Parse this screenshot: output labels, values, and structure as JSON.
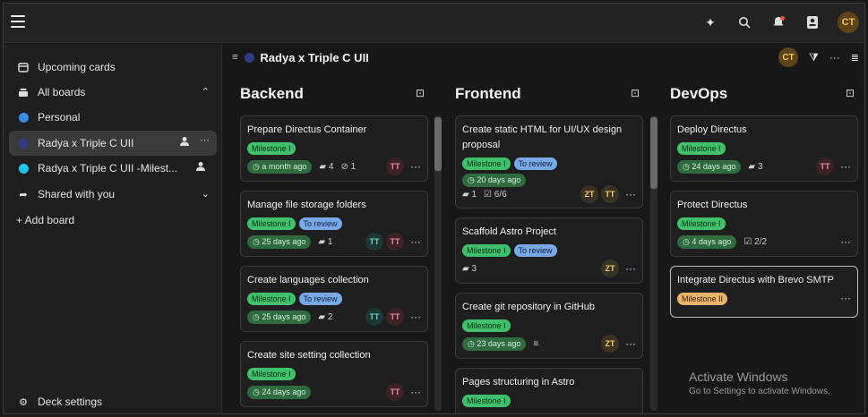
{
  "sidebar": {
    "upcoming": "Upcoming cards",
    "all_boards": "All boards",
    "personal": "Personal",
    "radya": "Radya x Triple C UII",
    "radya_milestone": "Radya x Triple C UII -Milest...",
    "shared": "Shared with you",
    "add_board": "+ Add board",
    "settings": "Deck settings",
    "colors": {
      "personal": "#3b8fe0",
      "radya": "#2f3d80",
      "milestone": "#20c6e8"
    }
  },
  "topbar": {
    "avatar": "CT"
  },
  "board": {
    "title": "Radya x Triple C UII",
    "avatar": "CT"
  },
  "columns": [
    {
      "title": "Backend",
      "cards": [
        {
          "title": "Prepare Directus Container",
          "tags": [
            "Milestone I"
          ],
          "due": "a month ago",
          "comments": "4",
          "attachments": "1",
          "avatars": [
            "TT"
          ]
        },
        {
          "title": "Manage file storage folders",
          "tags": [
            "Milestone I",
            "To review"
          ],
          "due": "25 days ago",
          "comments": "1",
          "avatars": [
            "TT",
            "TT"
          ]
        },
        {
          "title": "Create languages collection",
          "tags": [
            "Milestone I",
            "To review"
          ],
          "due": "25 days ago",
          "comments": "2",
          "avatars": [
            "TT",
            "TT"
          ]
        },
        {
          "title": "Create site setting collection",
          "tags": [
            "Milestone I"
          ],
          "due": "24 days ago",
          "avatars": [
            "TT"
          ]
        }
      ]
    },
    {
      "title": "Frontend",
      "cards": [
        {
          "title": "Create static HTML for UI/UX design proposal",
          "tags": [
            "Milestone I",
            "To review"
          ],
          "due": "20 days ago",
          "comments": "1",
          "checklist": "6/6",
          "avatars": [
            "ZT",
            "TT"
          ]
        },
        {
          "title": "Scaffold Astro Project",
          "tags": [
            "Milestone I",
            "To review"
          ],
          "comments": "3",
          "avatars": [
            "ZT"
          ]
        },
        {
          "title": "Create git repository in GitHub",
          "tags": [
            "Milestone I"
          ],
          "due": "23 days ago",
          "avatars": [
            "ZT"
          ]
        },
        {
          "title": "Pages structuring in Astro",
          "tags": [
            "Milestone I"
          ]
        }
      ]
    },
    {
      "title": "DevOps",
      "cards": [
        {
          "title": "Deploy Directus",
          "tags": [
            "Milestone I"
          ],
          "due": "24 days ago",
          "comments": "3",
          "avatars": [
            "TT"
          ]
        },
        {
          "title": "Protect Directus",
          "tags": [
            "Milestone I"
          ],
          "due": "4 days ago",
          "checklist": "2/2"
        },
        {
          "title": "Integrate Directus with Brevo SMTP",
          "tags": [
            "Milestone II"
          ]
        }
      ]
    }
  ],
  "watermark": {
    "line1": "Activate Windows",
    "line2": "Go to Settings to activate Windows."
  }
}
